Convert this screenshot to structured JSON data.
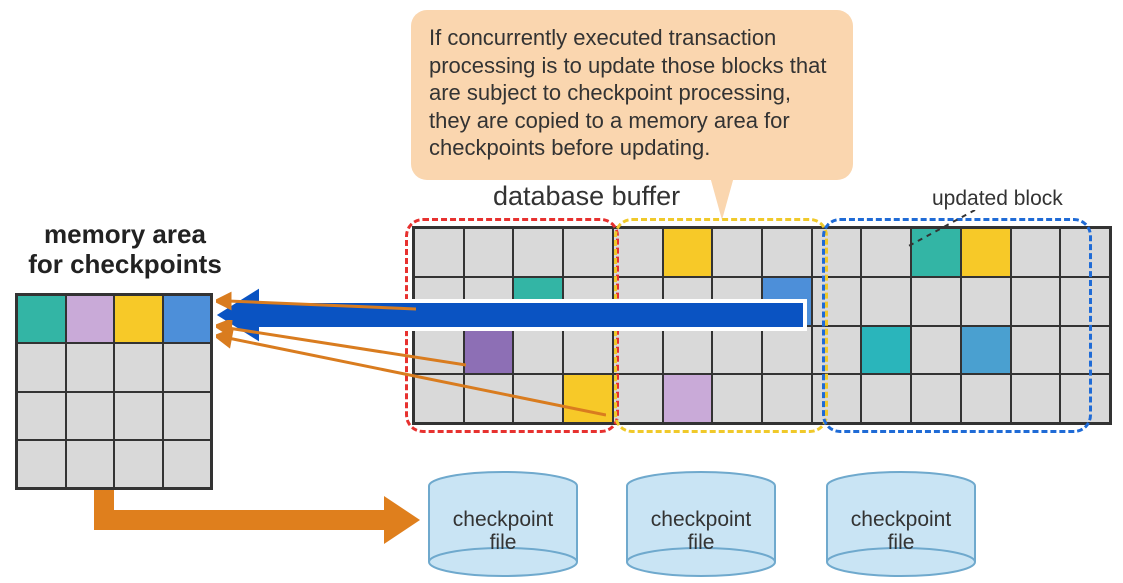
{
  "callout_text": "If concurrently executed transaction processing is to update those blocks that are subject to checkpoint processing, they are copied to a memory area for checkpoints before updating.",
  "labels": {
    "database_buffer": "database buffer",
    "updated_block": "updated block",
    "memory_area_line1": "memory area",
    "memory_area_line2": "for checkpoints",
    "checkpoint_file": "checkpoint\nfile"
  },
  "colors": {
    "callout_bg": "#fad6af",
    "cell_gray": "#d9d9d9",
    "teal": "#33b5a5",
    "lilac": "#c9aad8",
    "yellow": "#f7c928",
    "blue": "#4d8fd9",
    "purple": "#8d6fb5",
    "red_dash": "#e7312f",
    "yellow_dash": "#f0c92a",
    "blue_dash": "#1f6bd6",
    "big_arrow": "#0a53c2",
    "thin_arrow": "#d97c1f",
    "cylinder_fill": "#c9e4f4",
    "cylinder_stroke": "#6fa9cd"
  },
  "checkpoint_grid": {
    "cols": 4,
    "rows": 4,
    "cells": [
      "teal",
      "lilac",
      "yellow",
      "blue",
      "",
      "",
      "",
      "",
      "",
      "",
      "",
      "",
      "",
      "",
      "",
      ""
    ]
  },
  "db_buffer": {
    "cols": 14,
    "rows": 4,
    "cells": [
      "",
      "",
      "",
      "",
      "",
      "yellow",
      "",
      "",
      "",
      "",
      "teal",
      "yellow",
      "",
      "",
      "",
      "",
      "teal",
      "",
      "",
      "",
      "",
      "blue",
      "",
      "",
      "",
      "",
      "",
      "",
      "",
      "purple",
      "",
      "",
      "",
      "",
      "",
      "",
      "",
      "cyan",
      "",
      "mblue",
      "",
      "",
      "",
      "",
      "",
      "yellow",
      "",
      "lilac",
      "",
      "",
      "",
      "",
      "",
      "",
      "",
      ""
    ],
    "groups": [
      {
        "name": "red",
        "cols": [
          0,
          3
        ]
      },
      {
        "name": "yellow",
        "cols": [
          4,
          7
        ]
      },
      {
        "name": "blue",
        "cols": [
          8,
          13
        ]
      }
    ]
  },
  "cylinders": 3
}
